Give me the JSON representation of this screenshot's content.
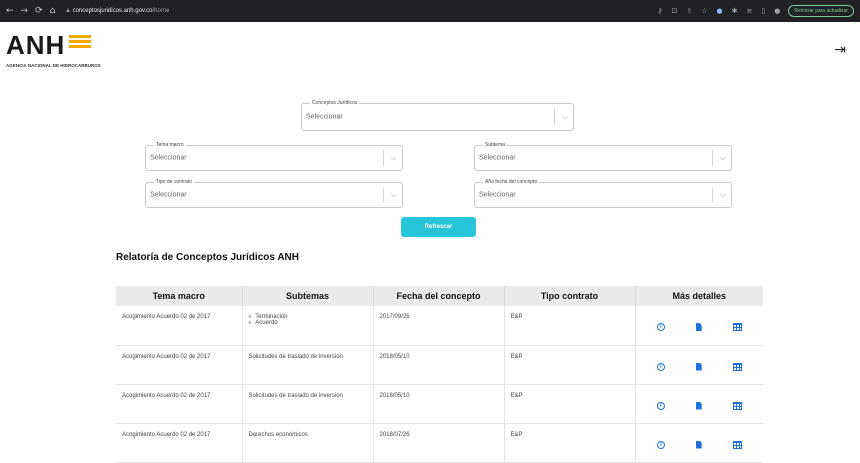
{
  "browser": {
    "url_host": "conceptosjuridicos.anh.gov.co",
    "url_path": "/home",
    "update_label": "Reiniciar para actualizar"
  },
  "header": {
    "logo_text": "ANH",
    "logo_tagline": "AGENCIA NACIONAL DE HIDROCARBUROS",
    "logo_colors": [
      "#f2a900",
      "#f2a900",
      "#f2a900"
    ]
  },
  "filters": {
    "conceptos": {
      "label": "Conceptos Jurídicos",
      "value": "Seleccionar"
    },
    "tema_macro": {
      "label": "Tema macro",
      "value": "Seleccionar"
    },
    "subtema": {
      "label": "Subtema",
      "value": "Seleccionar"
    },
    "tipo_contrato": {
      "label": "Tipo de contrato",
      "value": "Seleccionar"
    },
    "anio_fecha": {
      "label": "Año fecha del concepto",
      "value": "Seleccionar"
    }
  },
  "refresh_label": "Refrescar",
  "section_title": "Relatoría de Conceptos Jurídicos ANH",
  "table": {
    "headers": [
      "Tema macro",
      "Subtemas",
      "Fecha del concepto",
      "Tipo contrato",
      "Más detalles"
    ],
    "rows": [
      {
        "tema": "Acogimiento Acuerdo 02 de 2017",
        "subtemas": [
          "Terminación",
          "Acuerdo"
        ],
        "fecha": "2017/09/25",
        "tipo": "E&P"
      },
      {
        "tema": "Acogimiento Acuerdo 02 de 2017",
        "subtema_text": "Solicitudes de traslado de inversión",
        "fecha": "2018/05/10",
        "tipo": "E&P"
      },
      {
        "tema": "Acogimiento Acuerdo 02 de 2017",
        "subtema_text": "Solicitudes de traslado de inversión",
        "fecha": "2018/05/10",
        "tipo": "E&P"
      },
      {
        "tema": "Acogimiento Acuerdo 02 de 2017",
        "subtema_text": "Derechos económicos",
        "fecha": "2018/07/26",
        "tipo": "E&P"
      }
    ]
  }
}
